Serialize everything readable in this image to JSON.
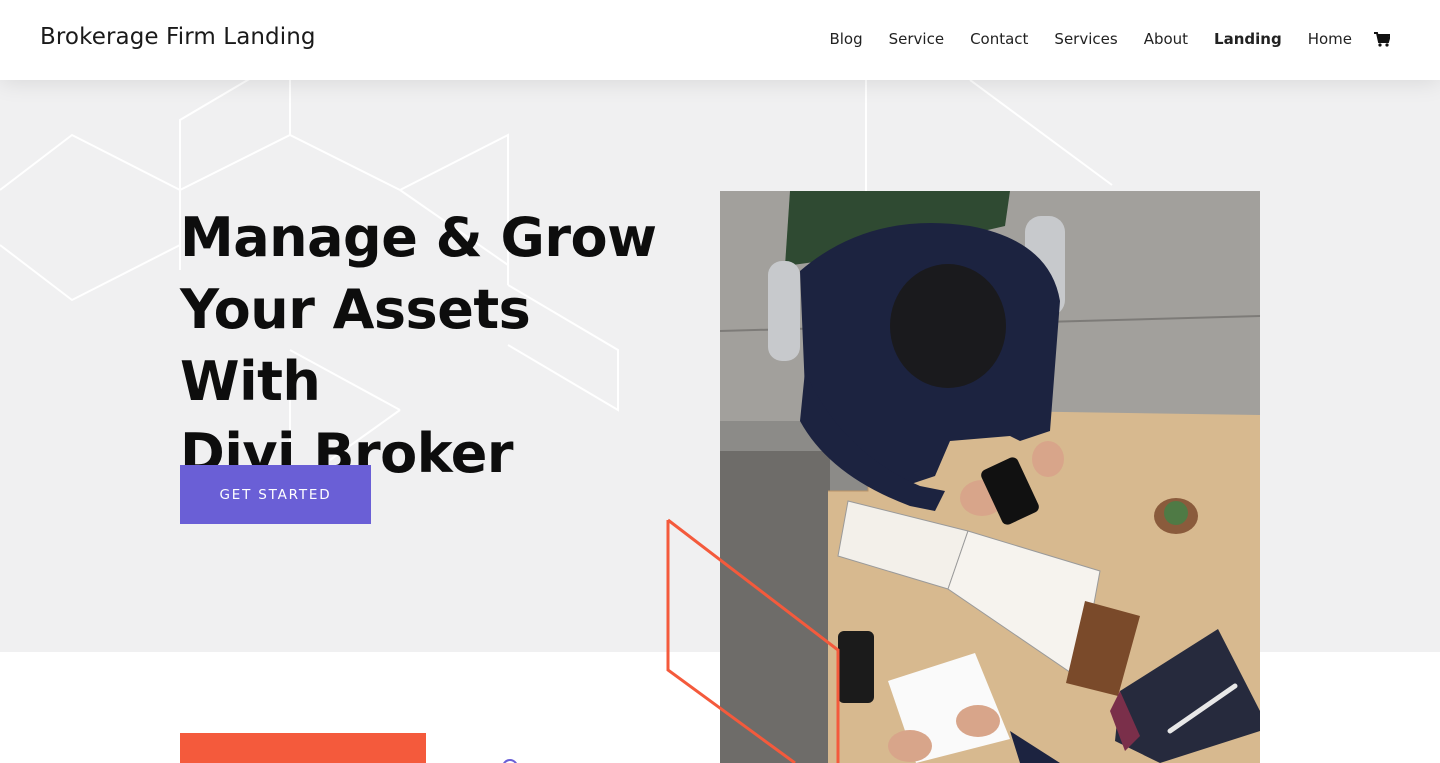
{
  "site": {
    "title": "Brokerage Firm Landing"
  },
  "nav": {
    "items": [
      {
        "label": "Blog",
        "active": false
      },
      {
        "label": "Service",
        "active": false
      },
      {
        "label": "Contact",
        "active": false
      },
      {
        "label": "Services",
        "active": false
      },
      {
        "label": "About",
        "active": false
      },
      {
        "label": "Landing",
        "active": true
      },
      {
        "label": "Home",
        "active": false
      }
    ],
    "cart_icon": "shopping-cart-icon"
  },
  "hero": {
    "headline_lines": [
      "Manage & Grow",
      "Your Assets With",
      "Divi Broker"
    ],
    "cta_label": "GET STARTED",
    "image_icon": "businessman-desk-photo"
  },
  "colors": {
    "accent_purple": "#6a5fd6",
    "accent_orange": "#f45a3c",
    "hero_bg": "#f0f0f1",
    "header_bg": "#ffffff"
  }
}
